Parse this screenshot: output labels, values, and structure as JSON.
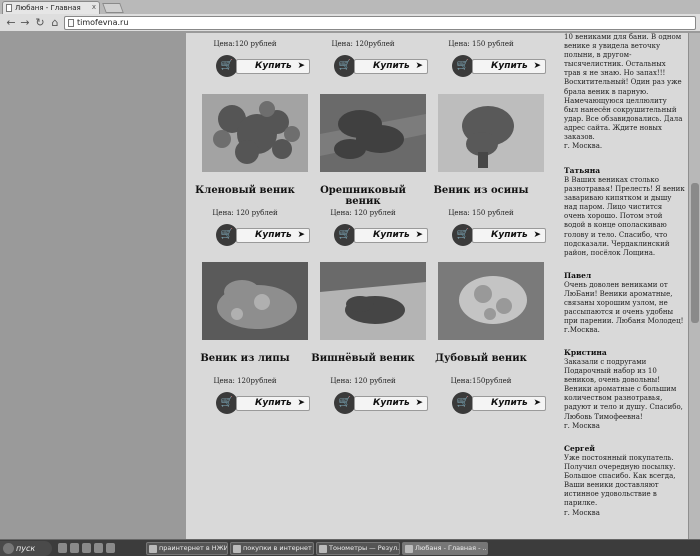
{
  "browser": {
    "tab_title": "Любаня - Главная",
    "close_symbol": "x",
    "url": "timofevna.ru",
    "nav_icons": [
      "back-icon",
      "forward-icon",
      "reload-icon",
      "home-icon"
    ]
  },
  "products": {
    "buy_label": "Купить",
    "top_prices": [
      "Цена:120 рублей",
      "Цена: 120рублей",
      "Цена: 150 рублей"
    ],
    "row1": [
      {
        "name": "Кленовый веник",
        "price": "Цена: 120 рублей"
      },
      {
        "name": "Орешниковый веник",
        "price": "Цена: 120 рублей"
      },
      {
        "name": "Веник из осины",
        "price": "Цена: 150 рублей"
      }
    ],
    "row2": [
      {
        "name": "Веник из липы",
        "price": "Цена: 120рублей"
      },
      {
        "name": "Вишнёвый веник",
        "price": "Цена: 120 рублей"
      },
      {
        "name": "Дубовый веник",
        "price": "Цена:150рублей"
      }
    ]
  },
  "reviews": {
    "first_text": "10 вениками для бани. В одном\nвенике я увидела веточку\nполыни, в другом-\nтысячелистник. Остальных\nтрав я не знаю. Но запах!!!\nВосхитительный! Один раз уже\nбрала веник в парную.\nНамечающуюся целлюлиту\nбыл нанесён сокрушительный\nудар. Все обзавидовались. Дала\nадрес сайта. Ждите новых\nзаказов.\nг. Москва.",
    "items": [
      {
        "name": "Татьяна",
        "text": "В Ваших вениках столько\nразнотравья! Прелесть! Я веник\nзавариваю кипятком и дышу\nнад паром. Лицо чистится\nочень хорошо. Потом этой\nводой в конце ополаскиваю\nголову и тело. Спасибо, что\nподсказали. Чердаклинский\nрайон, посёлок Лощина."
      },
      {
        "name": "Павел",
        "text": "Очень доволен вениками от\nЛюБани! Веники ароматные,\nсвязаны хорошим узлом, не\nрассыпаются и очень удобны\nпри парении. Любаня Молодец!\nг.Москва."
      },
      {
        "name": "Кристина",
        "text": "Заказали с подругами\nПодарочный набор из 10\nвеников, очень довольны!\nВеники ароматные с большим\nколичеством разнотравья,\nрадуют и тело и душу. Спасибо,\nЛюбовь Тимофеевна!\nг. Москва"
      },
      {
        "name": "Сергей",
        "text": "Уже постоянный покупатель.\nПолучил очередную посылку.\nБольшое спасибо. Как всегда,\nВаши веники доставляют\nистинное удовольствие в\nпарилке.\nг. Москва"
      }
    ]
  },
  "taskbar": {
    "start_label": "пуск",
    "tasks": [
      "праинтернет в НЖИД",
      "покупки в интернет ...",
      "Тонометры — Резул...",
      "Любаня - Главная - ..."
    ]
  }
}
